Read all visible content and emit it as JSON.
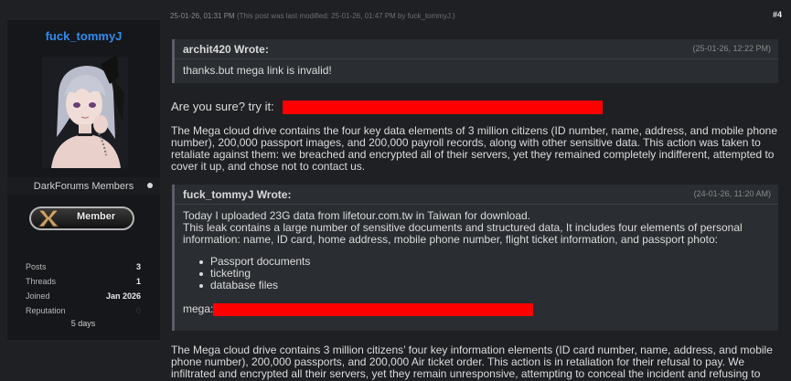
{
  "sidebar": {
    "username": "fuck_tommyJ",
    "group": "DarkForums Members",
    "badge_label": "Member",
    "stats": [
      {
        "label": "Posts",
        "value": "3"
      },
      {
        "label": "Threads",
        "value": "1"
      },
      {
        "label": "Joined",
        "value": "Jan 2026"
      },
      {
        "label": "Reputation",
        "value": "0"
      }
    ],
    "time_online": "5 days"
  },
  "post": {
    "date": "25-01-26, 01:31 PM",
    "modified": "(This post was last modified: 25-01-26, 01:47 PM by fuck_tommyJ.)",
    "number": "#4",
    "quote1": {
      "author": "archit420 Wrote:",
      "date": "(25-01-26, 12:22 PM)",
      "text": "thanks.but mega link is invalid!"
    },
    "reply": "Are you sure? try it:",
    "paragraph1": "The Mega cloud drive contains the four key data elements of 3 million citizens (ID number, name, address, and mobile phone number), 200,000 passport images, and 200,000 payroll records, along with other sensitive data. This action was taken to retaliate against them: we breached and encrypted all of their servers, yet they remained completely indifferent, attempted to cover it up, and chose not to contact us.",
    "quote2": {
      "author": "fuck_tommyJ Wrote:",
      "date": "(24-01-26, 11:20 AM)",
      "line1": "Today I uploaded 23G data from lifetour.com.tw in Taiwan for download.",
      "line2": "This leak contains a large number of sensitive documents and structured data, It includes four elements of personal information: name, ID card, home address, mobile phone number, flight ticket information, and passport photo:",
      "items": [
        "Passport documents",
        "ticketing",
        "database files"
      ],
      "mega_label": "mega:"
    },
    "paragraph2": "The Mega cloud drive contains 3 million citizens’ four key information elements (ID card number, name, address, and mobile phone number), 200,000 passports, and 200,000 Air ticket order. This action is in retaliation for their refusal to pay. We infiltrated and encrypted all their servers, yet they remain unresponsive, attempting to conceal the incident and refusing to contact us."
  },
  "colors": {
    "background": "#1e2023",
    "sidebar": "#15171a",
    "username": "#2f8cf0",
    "quote_bg": "#2a2d31",
    "redaction": "#ff0000"
  }
}
